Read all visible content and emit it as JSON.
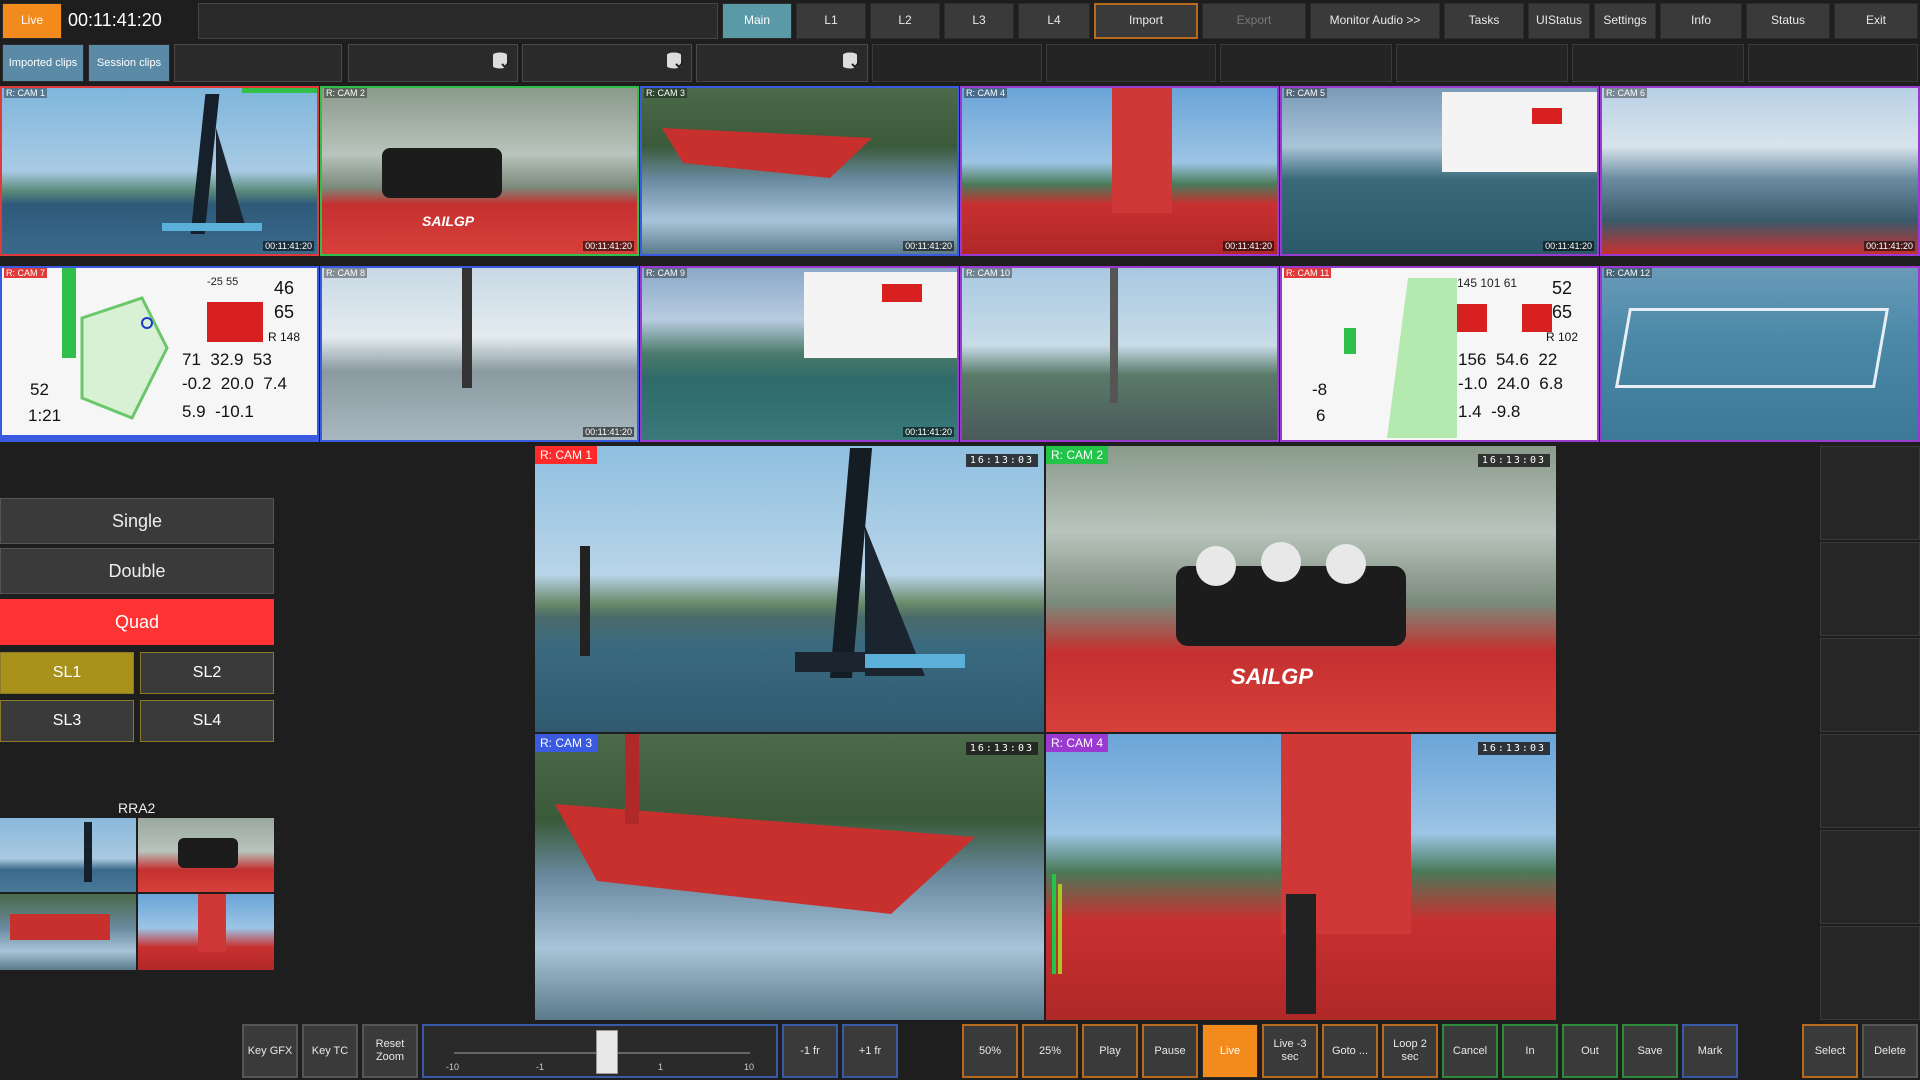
{
  "header": {
    "live_label": "Live",
    "timecode": "00:11:41:20",
    "tabs": [
      {
        "label": "Main",
        "active": true
      },
      {
        "label": "L1"
      },
      {
        "label": "L2"
      },
      {
        "label": "L3"
      },
      {
        "label": "L4"
      },
      {
        "label": "Import"
      },
      {
        "label": "Export",
        "disabled": true
      },
      {
        "label": "Monitor Audio >>"
      },
      {
        "label": "Tasks"
      },
      {
        "label": "UIStatus"
      },
      {
        "label": "Settings"
      },
      {
        "label": "Info"
      },
      {
        "label": "Status"
      },
      {
        "label": "Exit"
      }
    ]
  },
  "clip_bar": {
    "imported_label": "Imported clips",
    "session_label": "Session clips"
  },
  "multiview": {
    "timecode": "00:11:41:20",
    "tiles": [
      {
        "label": "R: CAM 1"
      },
      {
        "label": "R: CAM 2"
      },
      {
        "label": "R: CAM 3"
      },
      {
        "label": "R: CAM 4"
      },
      {
        "label": "R: CAM 5"
      },
      {
        "label": "R: CAM 6"
      },
      {
        "label": "R: CAM 7"
      },
      {
        "label": "R: CAM 8"
      },
      {
        "label": "R: CAM 9"
      },
      {
        "label": "R: CAM 10"
      },
      {
        "label": "R: CAM 11"
      },
      {
        "label": "R: CAM 12"
      }
    ],
    "hud_cam7": [
      "46",
      "65",
      "71",
      "32.9",
      "53",
      "-0.2",
      "20.0",
      "7.4",
      "5.9",
      "-10.1",
      "52",
      "1:21",
      "-25",
      "55",
      "R 148"
    ],
    "hud_cam11": [
      "145",
      "101",
      "61",
      "52",
      "65",
      "156",
      "54.6",
      "22",
      "-1.0",
      "24.0",
      "6.8",
      "1.4",
      "-9.8",
      "-8",
      "6",
      "R 102"
    ]
  },
  "layout": {
    "single": "Single",
    "double": "Double",
    "quad": "Quad",
    "sl1": "SL1",
    "sl2": "SL2",
    "sl3": "SL3",
    "sl4": "SL4",
    "rra_label": "RRA2"
  },
  "quad": {
    "timecode": "16:13:03",
    "panes": [
      {
        "label": "R: CAM 1",
        "color": "#ff2a2a"
      },
      {
        "label": "R: CAM 2",
        "color": "#22c44a"
      },
      {
        "label": "R: CAM 3",
        "color": "#3a5ae0"
      },
      {
        "label": "R: CAM 4",
        "color": "#9b3ad0"
      }
    ]
  },
  "bottom": {
    "key_gfx": "Key GFX",
    "key_tc": "Key TC",
    "reset_zoom": "Reset Zoom",
    "jog_ticks": [
      "-10",
      "-1",
      "1",
      "10"
    ],
    "minus1": "-1 fr",
    "plus1": "+1 fr",
    "p50": "50%",
    "p25": "25%",
    "play": "Play",
    "pause": "Pause",
    "live": "Live",
    "live3": "Live -3 sec",
    "goto": "Goto ...",
    "loop": "Loop 2 sec",
    "cancel": "Cancel",
    "in": "In",
    "out": "Out",
    "save": "Save",
    "mark": "Mark",
    "select": "Select",
    "delete": "Delete"
  },
  "colors": {
    "live_orange": "#f28a1c",
    "quad_red": "#ff3333",
    "sl_gold": "#a8921c",
    "teal": "#5a9aa6"
  }
}
